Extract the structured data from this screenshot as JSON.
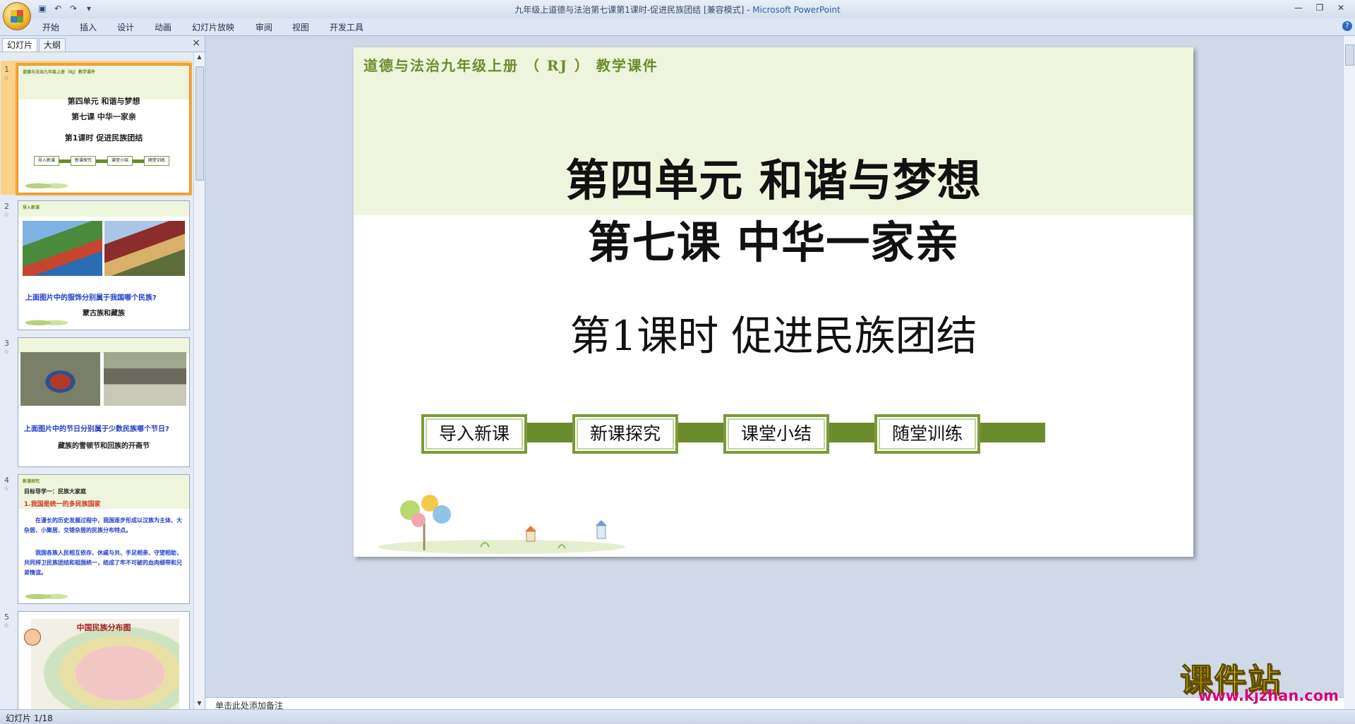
{
  "window": {
    "title": "九年级上道德与法治第七课第1课时-促进民族团结 [兼容模式] - ",
    "app_name": "Microsoft PowerPoint",
    "controls": [
      "minimize-icon",
      "restore-icon",
      "close-icon"
    ]
  },
  "quick_access": [
    "save-icon",
    "undo-icon",
    "redo-icon",
    "customize-icon"
  ],
  "ribbon_tabs": [
    "开始",
    "插入",
    "设计",
    "动画",
    "幻灯片放映",
    "审阅",
    "视图",
    "开发工具"
  ],
  "pane": {
    "tabs": [
      "幻灯片",
      "大纲"
    ],
    "close": "×"
  },
  "thumbnails": [
    {
      "num": "1",
      "header": "道德与法治九年级上册（RJ）教学课件",
      "lines": [
        "第四单元  和谐与梦想",
        "第七课  中华一家亲",
        "第1课时  促进民族团结"
      ],
      "buttons": [
        "导入新课",
        "新课探究",
        "课堂小结",
        "随堂训练"
      ]
    },
    {
      "num": "2",
      "header": "导入新课",
      "question": "上面图片中的服饰分别属于我国哪个民族?",
      "answer": "蒙古族和藏族"
    },
    {
      "num": "3",
      "question": "上面图片中的节日分别属于少数民族哪个节日?",
      "answer": "藏族的雪顿节和回族的开斋节"
    },
    {
      "num": "4",
      "header": "新课探究",
      "subtitle": "目标导学一：民族大家庭",
      "point": "1.我国是统一的多民族国家",
      "para1": "在漫长的历史发展过程中，我国逐步形成以汉族为主体、大杂居、小聚居、交错杂居的民族分布特点。",
      "para2": "我国各族人民相互依存、休戚与共、手足相亲、守望相助，共同捍卫民族团结和祖国统一，结成了牢不可破的血肉细带和兄弟情谊。"
    },
    {
      "num": "5",
      "map_title": "中国民族分布图"
    }
  ],
  "slide": {
    "header": "道德与法治九年级上册 （ RJ ） 教学课件",
    "title1": "第四单元  和谐与梦想",
    "title2": "第七课  中华一家亲",
    "title3": "第1课时  促进民族团结",
    "buttons": [
      "导入新课",
      "新课探究",
      "课堂小结",
      "随堂训练"
    ],
    "accent": "#6b8c2d"
  },
  "notes_placeholder": "单击此处添加备注",
  "status": "幻灯片 1/18",
  "watermark": {
    "text": "课件站",
    "url": "www.kjzhan.com"
  }
}
